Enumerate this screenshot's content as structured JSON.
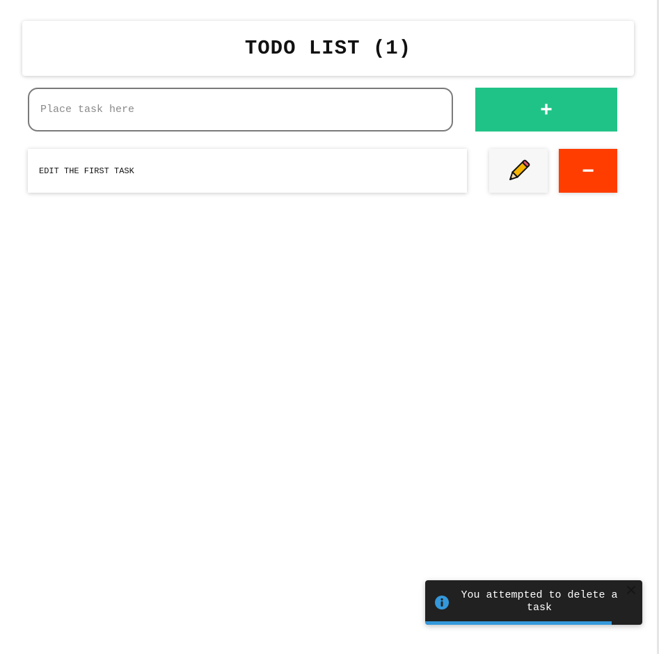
{
  "header": {
    "title": "TODO LIST (1)"
  },
  "new_task": {
    "placeholder": "Place task here",
    "value": "",
    "add_label": "+"
  },
  "tasks": [
    {
      "text": "EDIT THE FIRST TASK",
      "edit_icon": "pencil-icon",
      "delete_label": "−"
    }
  ],
  "toast": {
    "type_icon": "info-icon",
    "message": "You attempted to delete a task",
    "close_icon": "close-icon",
    "progress": 0.86
  },
  "colors": {
    "add": "#20c387",
    "delete": "#ff3d00",
    "toast_bg": "#212121",
    "toast_progress": "#3498db",
    "info_icon": "#3498db"
  }
}
